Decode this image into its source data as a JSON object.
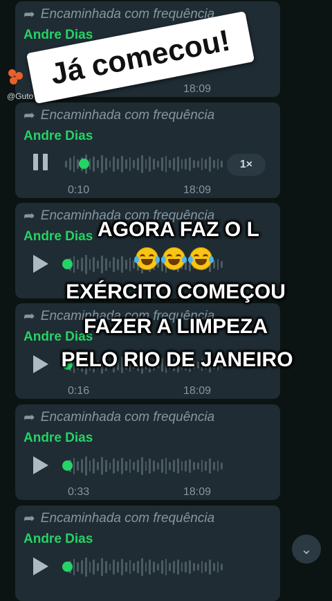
{
  "messages": [
    {
      "forwarded": "Encaminhada com frequência",
      "sender": "Andre Dias",
      "duration": "",
      "time": "18:09",
      "state": "play"
    },
    {
      "forwarded": "Encaminhada com frequência",
      "sender": "Andre Dias",
      "duration": "0:10",
      "time": "18:09",
      "state": "pause",
      "speed": "1×"
    },
    {
      "forwarded": "Encaminhada com frequência",
      "sender": "Andre Dias",
      "duration": "",
      "time": "",
      "state": "play"
    },
    {
      "forwarded": "Encaminhada com frequência",
      "sender": "Andre Dias",
      "duration": "0:16",
      "time": "18:09",
      "state": "play"
    },
    {
      "forwarded": "Encaminhada com frequência",
      "sender": "Andre Dias",
      "duration": "0:33",
      "time": "18:09",
      "state": "play"
    },
    {
      "forwarded": "Encaminhada com frequência",
      "sender": "Andre Dias",
      "duration": "",
      "time": "",
      "state": "play"
    }
  ],
  "sticker_text": "Já comecou!",
  "watermark": "@Guto",
  "overlay": {
    "line1": "AGORA FAZ O L",
    "line2": "EXÉRCITO COMEÇOU",
    "line3": "FAZER A LIMPEZA",
    "line4": "PELO RIO DE JANEIRO"
  },
  "icons": {
    "forward": "forward-arrows-icon",
    "play": "play-icon",
    "pause": "pause-icon",
    "scroll": "scroll-down-icon"
  }
}
